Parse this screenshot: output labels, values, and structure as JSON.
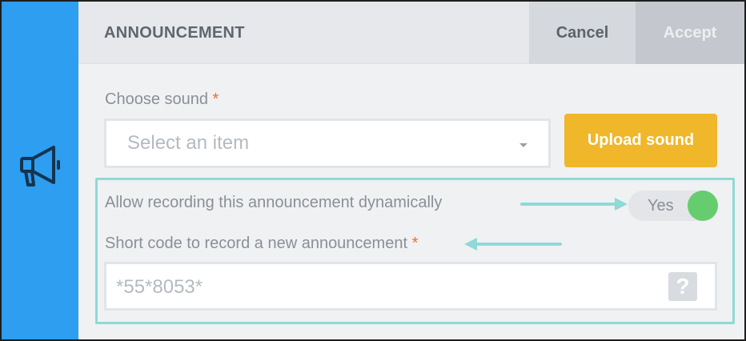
{
  "header": {
    "title": "ANNOUNCEMENT",
    "cancel_label": "Cancel",
    "accept_label": "Accept"
  },
  "sound": {
    "label": "Choose sound",
    "required_mark": "*",
    "placeholder": "Select an item",
    "upload_label": "Upload sound"
  },
  "dynamic_recording": {
    "label": "Allow recording this announcement dynamically",
    "toggle_label": "Yes",
    "enabled": true
  },
  "short_code": {
    "label": "Short code to record a new announcement",
    "required_mark": "*",
    "value": "*55*8053*",
    "help_glyph": "?"
  },
  "icons": {
    "rail": "megaphone-icon",
    "help": "question-icon",
    "dropdown": "chevron-down-icon"
  },
  "colors": {
    "rail": "#2d9ef0",
    "upload_button": "#f0b72a",
    "toggle_on": "#66cd6f",
    "highlight": "#8fd9d6",
    "required": "#f26b3a"
  }
}
